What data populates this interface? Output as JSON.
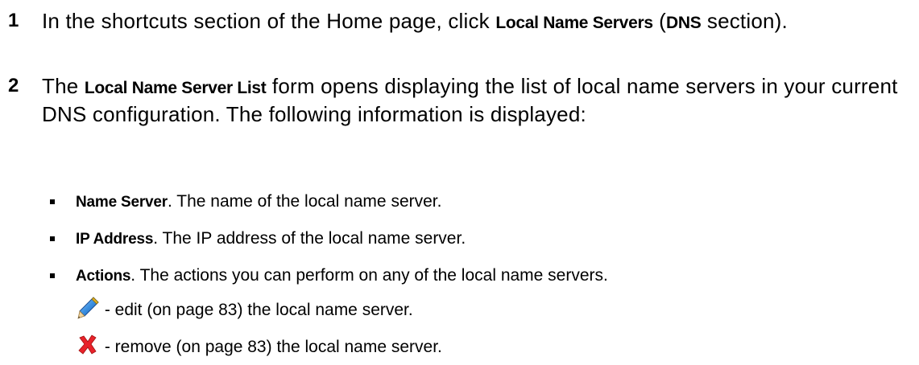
{
  "steps": [
    {
      "number": "1",
      "text_before": "In the shortcuts section of the Home page, click ",
      "term": "Local Name Servers",
      "text_middle": " (",
      "term2": "DNS",
      "text_after": " section)."
    },
    {
      "number": "2",
      "text_before": "The ",
      "term": "Local Name Server List",
      "text_after": " form opens displaying the list of local name servers in your current DNS configuration. The following information is displayed:"
    }
  ],
  "bullets": [
    {
      "term": "Name Server",
      "text": ". The name of the local name server."
    },
    {
      "term": "IP Address",
      "text": ". The IP address of the local name server."
    },
    {
      "term": "Actions",
      "text": ". The actions you can perform on any of the local name servers."
    }
  ],
  "actions": [
    {
      "icon": "pencil-icon",
      "text": " - edit (on page 83) the local name server."
    },
    {
      "icon": "red-x-icon",
      "text": " - remove (on page 83) the local name server."
    }
  ]
}
